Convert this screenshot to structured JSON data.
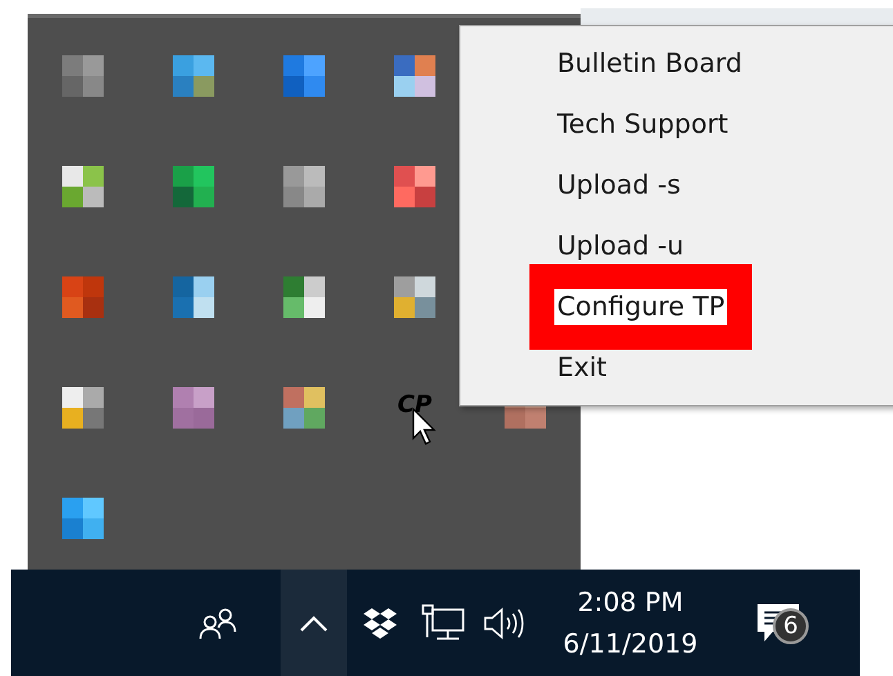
{
  "tray_overflow": {
    "cp_icon": {
      "label": "CP"
    }
  },
  "context_menu": {
    "items": [
      {
        "label": "Bulletin Board",
        "selected": false
      },
      {
        "label": "Tech Support",
        "selected": false
      },
      {
        "label": "Upload -s",
        "selected": false
      },
      {
        "label": "Upload -u",
        "selected": false
      },
      {
        "label": "Configure TP",
        "selected": true
      },
      {
        "label": "Exit",
        "selected": false
      }
    ]
  },
  "taskbar": {
    "time": "2:08 PM",
    "date": "6/11/2019",
    "notification_count": "6"
  }
}
